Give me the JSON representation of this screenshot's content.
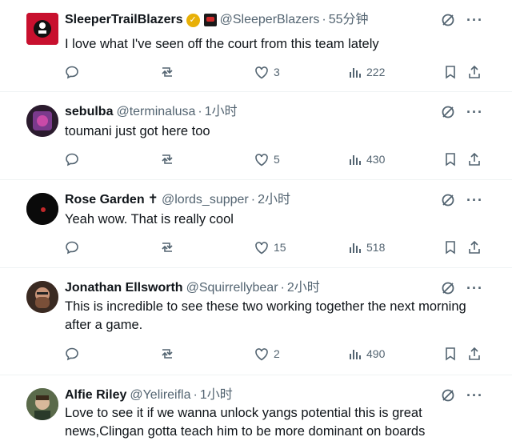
{
  "tweets": [
    {
      "name": "SleeperTrailBlazers",
      "handle": "@SleeperBlazers",
      "time": "55分钟",
      "text": "I love what I've seen off the court from this team lately",
      "likes": "3",
      "views": "222",
      "verified": true,
      "avatar_color": "#c8102e"
    },
    {
      "name": "sebulba",
      "handle": "@terminalusa",
      "time": "1小时",
      "text": "toumani just got here too",
      "likes": "5",
      "views": "430",
      "avatar_color": "#2b1b2e"
    },
    {
      "name": "Rose Garden",
      "handle": "@lords_supper",
      "time": "2小时",
      "text": "Yeah wow. That is really cool",
      "likes": "15",
      "views": "518",
      "name_suffix": "✝",
      "avatar_color": "#0a0a0a"
    },
    {
      "name": "Jonathan Ellsworth",
      "handle": "@Squirrellybear",
      "time": "2小时",
      "text": "This is incredible to see these two working together the next morning after a game.",
      "likes": "2",
      "views": "490",
      "avatar_color": "#6b4a3a"
    },
    {
      "name": "Alfie Riley",
      "handle": "@Yelireifla",
      "time": "1小时",
      "text": "Love to see it if we wanna unlock yangs potential this is great news,Clingan gotta teach him to be more dominant on boards",
      "avatar_color": "#4a5a3a"
    }
  ],
  "colors": {
    "text": "#0f1419",
    "muted": "#536471",
    "divider": "#eff3f4"
  }
}
